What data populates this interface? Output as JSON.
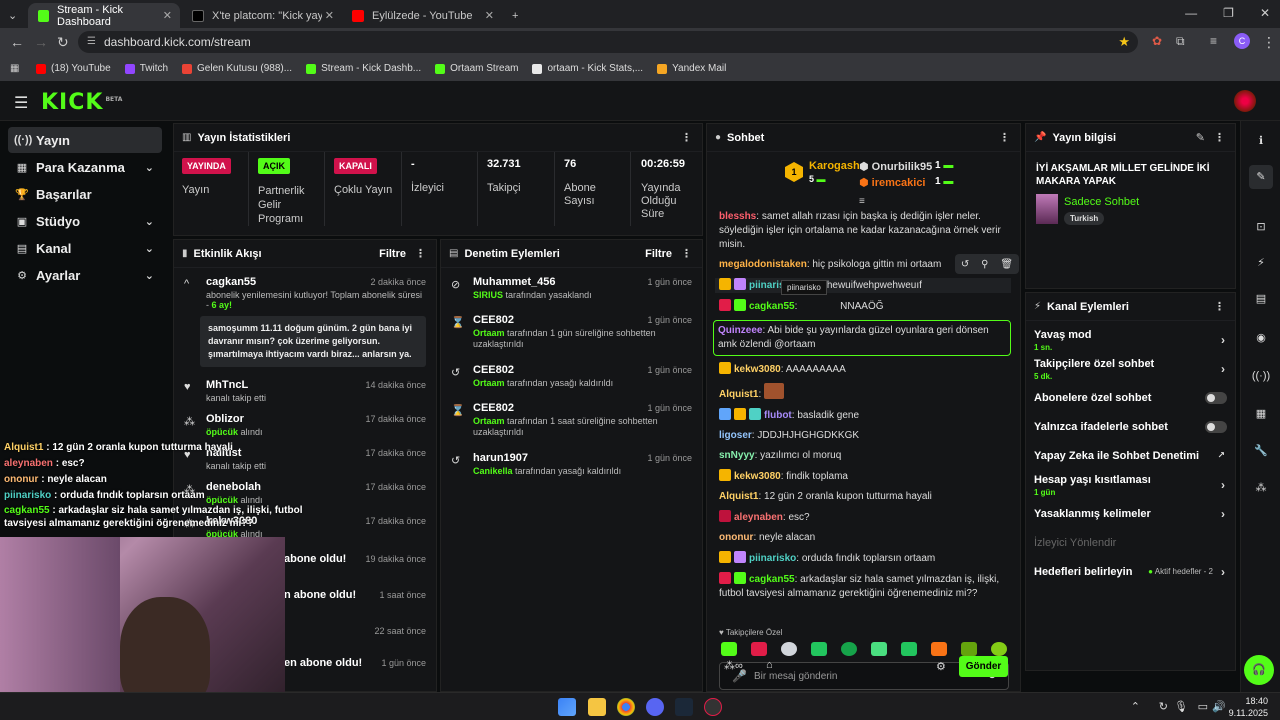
{
  "browser": {
    "tabs": [
      {
        "title": "Stream - Kick Dashboard",
        "color": "#53fc18"
      },
      {
        "title": "X'te platcom: \"Kick yayıncısı ve...",
        "color": "#000000"
      },
      {
        "title": "Eylülzede - YouTube",
        "color": "#ff0000"
      }
    ],
    "url": "dashboard.kick.com/stream",
    "bookmarks": [
      {
        "label": "(18) YouTube",
        "color": "#ff0000"
      },
      {
        "label": "Twitch",
        "color": "#9146ff"
      },
      {
        "label": "Gelen Kutusu (988)...",
        "color": "#ea4335"
      },
      {
        "label": "Stream - Kick Dashb...",
        "color": "#53fc18"
      },
      {
        "label": "Ortaam Stream",
        "color": "#53fc18"
      },
      {
        "label": "ortaam - Kick Stats,...",
        "color": "#e8e8e8"
      },
      {
        "label": "Yandex Mail",
        "color": "#f5a623"
      }
    ],
    "profile_letter": "C"
  },
  "kick": {
    "logo": "KICK",
    "logo_sup": "BETA",
    "nav": [
      {
        "label": "Yayın",
        "icon": "((·))"
      },
      {
        "label": "Para Kazanma",
        "icon": "▦"
      },
      {
        "label": "Başarılar",
        "icon": "🏆"
      },
      {
        "label": "Stüdyo",
        "icon": "▣"
      },
      {
        "label": "Kanal",
        "icon": "▤"
      },
      {
        "label": "Ayarlar",
        "icon": "⚙"
      }
    ],
    "stats": {
      "title": "Yayın İstatistikleri",
      "items": [
        {
          "badge": "YAYINDA",
          "label": "Yayın"
        },
        {
          "badge": "AÇIK",
          "label": "Partnerlik Gelir Programı"
        },
        {
          "badge": "KAPALI",
          "label": "Çoklu Yayın"
        },
        {
          "value": "-",
          "label": "İzleyici"
        },
        {
          "value": "32.731",
          "label": "Takipçi"
        },
        {
          "value": "76",
          "label": "Abone Sayısı"
        },
        {
          "value": "00:26:59",
          "label": "Yayında Olduğu Süre"
        }
      ]
    },
    "activity": {
      "title": "Etkinlik Akışı",
      "filter": "Filtre",
      "items": [
        {
          "name": "cagkan55",
          "time": "2 dakika önce",
          "text": "abonelik yenilemesini kutluyor! Toplam abonelik süresi -",
          "count": "6",
          "count_unit": "ay!",
          "message": "samoşumm 11.11 doğum günüm. 2 gün bana iyi davranır mısın? çok üzerime geliyorsun. şımartılmaya ihtiyacım vardı biraz... anlarsın ya."
        },
        {
          "name": "MhTncL",
          "time": "14 dakika önce",
          "text": "kanalı takip etti"
        },
        {
          "name": "Oblizor",
          "time": "17 dakika önce",
          "gift": "öpücük",
          "text": "alındı"
        },
        {
          "name": "nalitist",
          "time": "17 dakika önce",
          "text": "kanalı takip etti"
        },
        {
          "name": "denebolah",
          "time": "17 dakika önce",
          "gift": "öpücük",
          "text": "alındı"
        },
        {
          "name": "kekw3080",
          "time": "17 dakika önce",
          "gift": "öpücük",
          "text": "alındı"
        },
        {
          "name": "abone oldu!",
          "time": "19 dakika önce"
        },
        {
          "name": "n abone oldu!",
          "time": "1 saat önce"
        },
        {
          "name": "",
          "time": "22 saat önce"
        },
        {
          "name": "en abone oldu!",
          "time": "1 gün önce"
        }
      ]
    },
    "moderation": {
      "title": "Denetim Eylemleri",
      "filter": "Filtre",
      "items": [
        {
          "name": "Muhammet_456",
          "time": "1 gün önce",
          "actor": "SIRIUS",
          "text": "tarafından yasaklandı"
        },
        {
          "name": "CEE802",
          "time": "1 gün önce",
          "actor": "Ortaam",
          "text": "tarafından 1 gün süreliğine sohbetten uzaklaştırıldı"
        },
        {
          "name": "CEE802",
          "time": "1 gün önce",
          "actor": "Ortaam",
          "text": "tarafından yasağı kaldırıldı"
        },
        {
          "name": "CEE802",
          "time": "1 gün önce",
          "actor": "Ortaam",
          "text": "tarafından 1 saat süreliğine sohbetten uzaklaştırıldı"
        },
        {
          "name": "harun1907",
          "time": "1 gün önce",
          "actor": "Canikella",
          "text": "tarafından yasağı kaldırıldı"
        }
      ]
    },
    "chat": {
      "title": "Sohbet",
      "top_gifters": [
        {
          "rank": "1",
          "name": "Karogash",
          "count": "5"
        },
        {
          "name": "Onurbilik95",
          "count": "1"
        },
        {
          "name": "iremcakici",
          "count": "1"
        }
      ],
      "messages": [
        {
          "user": "blesshs",
          "color": "#ff5f6d",
          "text": "samet allah rızası için başka iş dediğin işler neler. söylediğin işler için ortalama ne kadar kazanacağına örnek verir misin."
        },
        {
          "user": "megalodonistaken",
          "color": "#ffb347",
          "text": "hiç psikologa gittin mi ortaam"
        },
        {
          "user": "piinarisko",
          "color": "#4fd1c5",
          "text": "ahuaıhewuifwehpwehweuıf"
        },
        {
          "user": "cagkan55",
          "color": "#53fc18",
          "text": "NNAAÖĞ"
        },
        {
          "user": "Quinzeee",
          "color": "#c084fc",
          "text": "Abi bide şu yayınlarda güzel oyunlara geri dönsen amk özlendi @ortaam"
        },
        {
          "user": "kekw3080",
          "color": "#ffd166",
          "text": "AAAAAAAAA"
        },
        {
          "user": "Alquist1",
          "color": "#ffd166",
          "text": ""
        },
        {
          "user": "flubot",
          "color": "#a78bfa",
          "text": "basladik gene"
        },
        {
          "user": "ligoser",
          "color": "#93c5fd",
          "text": "JDDJHJHGHGDKKGK"
        },
        {
          "user": "snNyyy",
          "color": "#86efac",
          "text": "yazılımcı ol moruq"
        },
        {
          "user": "kekw3080",
          "color": "#ffd166",
          "text": "findik toplama"
        },
        {
          "user": "Alquist1",
          "color": "#ffd166",
          "text": "12 gün 2 oranla kupon tutturma hayali"
        },
        {
          "user": "aleynaben",
          "color": "#f87171",
          "text": "esc?"
        },
        {
          "user": "ononur",
          "color": "#fdba74",
          "text": "neyle alacan"
        },
        {
          "user": "piinarisko",
          "color": "#4fd1c5",
          "text": "orduda fındık toplarsın ortaam"
        },
        {
          "user": "cagkan55",
          "color": "#53fc18",
          "text": "arkadaşlar siz hala samet yılmazdan iş, ilişki, futbol tavsiyesi almamanız gerektiğini öğrenemediniz mi??"
        }
      ],
      "tooltip": "piinarisko",
      "follower_only": "Takipçilere Özel",
      "input_placeholder": "Bir mesaj gönderin",
      "send": "Gönder"
    },
    "stream_info": {
      "title": "Yayın bilgisi",
      "stream_title": "İYİ AKŞAMLAR MİLLET GELİNDE İKİ MAKARA YAPAK",
      "category": "Sadece Sohbet",
      "tag": "Turkish"
    },
    "channel_actions": {
      "title": "Kanal Eylemleri",
      "items": [
        {
          "label": "Yavaş mod",
          "sub": "1 sn."
        },
        {
          "label": "Takipçilere özel sohbet",
          "sub": "5 dk."
        },
        {
          "label": "Abonelere özel sohbet"
        },
        {
          "label": "Yalnızca ifadelerle sohbet"
        },
        {
          "label": "Yapay Zeka ile Sohbet Denetimi"
        },
        {
          "label": "Hesap yaşı kısıtlaması",
          "sub": "1 gün"
        },
        {
          "label": "Yasaklanmış kelimeler"
        },
        {
          "label": "İzleyici Yönlendir"
        },
        {
          "label": "Hedefleri belirleyin",
          "extra": "Aktif hedefler - 2"
        }
      ]
    },
    "overlay_chat": [
      {
        "user": "Alquist1",
        "text": "12 gün 2 oranla kupon tutturma hayali"
      },
      {
        "user": "aleynaben",
        "text": "esc?"
      },
      {
        "user": "ononur",
        "text": "neyle alacan"
      },
      {
        "user": "piinarisko",
        "text": "orduda fındık toplarsın ortaam"
      },
      {
        "user": "cagkan55",
        "text": "arkadaşlar siz hala samet yılmazdan iş, ilişki, futbol tavsiyesi almamanız gerektiğini öğrenemediniz mi??"
      }
    ]
  },
  "taskbar": {
    "time": "18:40",
    "date": "9.11.2025"
  }
}
